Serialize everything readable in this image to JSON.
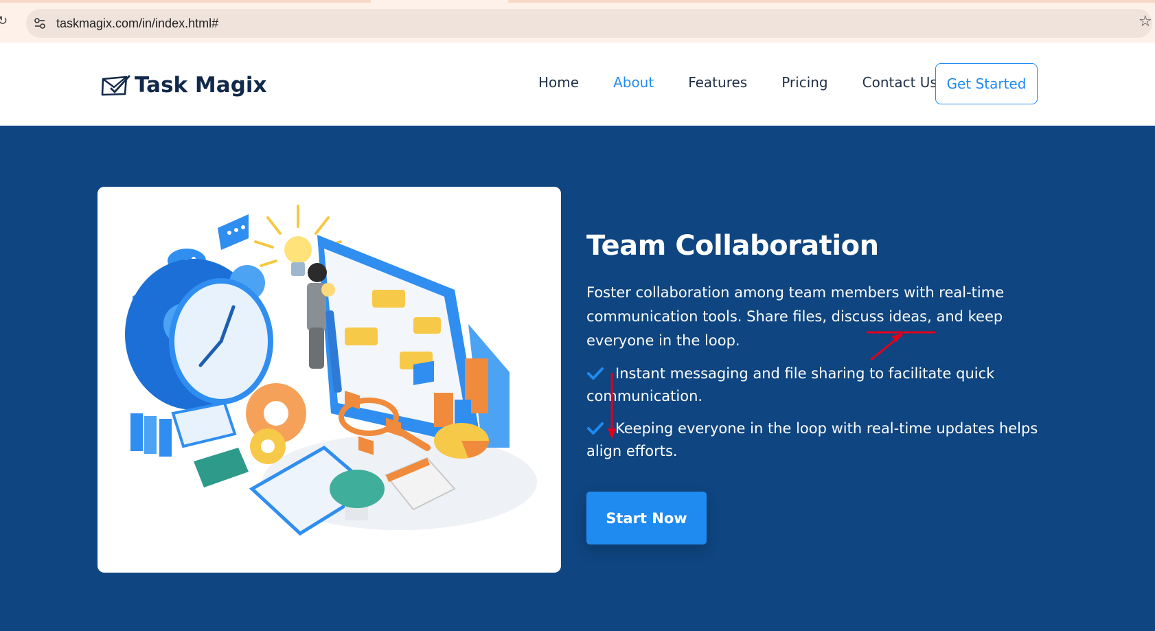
{
  "browser": {
    "url": "taskmagix.com/in/index.html#",
    "reload_icon": "reload-icon",
    "site_info_icon": "tune-icon",
    "bookmark_icon": "star-icon"
  },
  "header": {
    "logo_text": "Task Magix",
    "logo_icon": "envelope-check-icon",
    "nav": [
      {
        "label": "Home",
        "active": false
      },
      {
        "label": "About",
        "active": true
      },
      {
        "label": "Features",
        "active": false
      },
      {
        "label": "Pricing",
        "active": false
      },
      {
        "label": "Contact Us",
        "active": false
      }
    ],
    "cta_label": "Get Started"
  },
  "hero": {
    "heading": "Team Collaboration",
    "description": "Foster collaboration among team members with real-time communication tools. Share files, discuss ideas, and keep everyone in the loop.",
    "bullets": [
      "Instant messaging and file sharing to facilitate quick communication.",
      "Keeping everyone in the loop with real-time updates helps align efforts."
    ],
    "button_label": "Start Now",
    "illustration": "isometric-team-collaboration-illustration"
  },
  "colors": {
    "hero_background": "#0f4580",
    "accent": "#1f8bf0",
    "nav_text": "#1f2f45",
    "logo_text": "#11294a",
    "annotation_red": "#e3001b"
  }
}
